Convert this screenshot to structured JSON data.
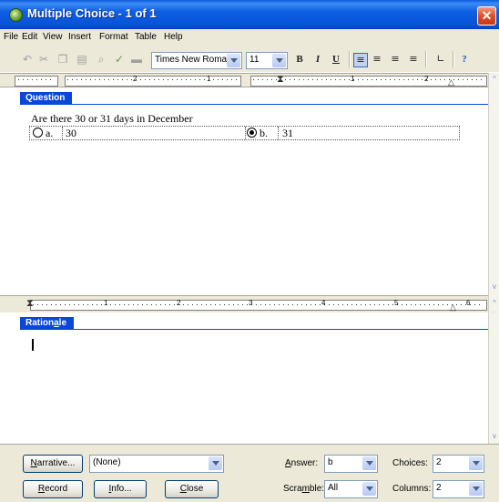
{
  "window": {
    "title": "Multiple Choice - 1 of 1",
    "close_glyph": "✕"
  },
  "menu": [
    "File",
    "Edit",
    "View",
    "Insert",
    "Format",
    "Table",
    "Help"
  ],
  "toolbar": {
    "icons": [
      "undo-icon",
      "cut-icon",
      "copy-icon",
      "paste-icon",
      "find-icon",
      "spellcheck-icon",
      "image-icon"
    ],
    "font": "Times New Roman",
    "size": "11",
    "bold": "B",
    "italic": "I",
    "underline": "U"
  },
  "ruler_top": {
    "numbers": [
      "2",
      "1",
      "1",
      "2"
    ]
  },
  "ruler_mid": {
    "numbers": [
      "1",
      "2",
      "3",
      "4",
      "5",
      "6"
    ]
  },
  "question": {
    "label": "Question",
    "text": "Are there 30 or 31 days in December",
    "choices": [
      {
        "letter": "a.",
        "text": "30",
        "selected": false
      },
      {
        "letter": "b.",
        "text": "31",
        "selected": true
      }
    ]
  },
  "rationale": {
    "label": "Rationale",
    "text": ""
  },
  "bottom": {
    "narrative_button": "Narrative...",
    "narrative_value": "(None)",
    "answer_label": "Answer:",
    "answer_value": "b",
    "choices_label": "Choices:",
    "choices_value": "2",
    "record_button": "Record",
    "info_button": "Info...",
    "close_button": "Close",
    "scramble_label": "Scramble:",
    "scramble_value": "All",
    "columns_label": "Columns:",
    "columns_value": "2"
  },
  "colors": {
    "title_blue": "#0a5ae0",
    "section_blue": "#0a46d8",
    "close_red": "#e0502a",
    "window_bg": "#ece9d8"
  }
}
